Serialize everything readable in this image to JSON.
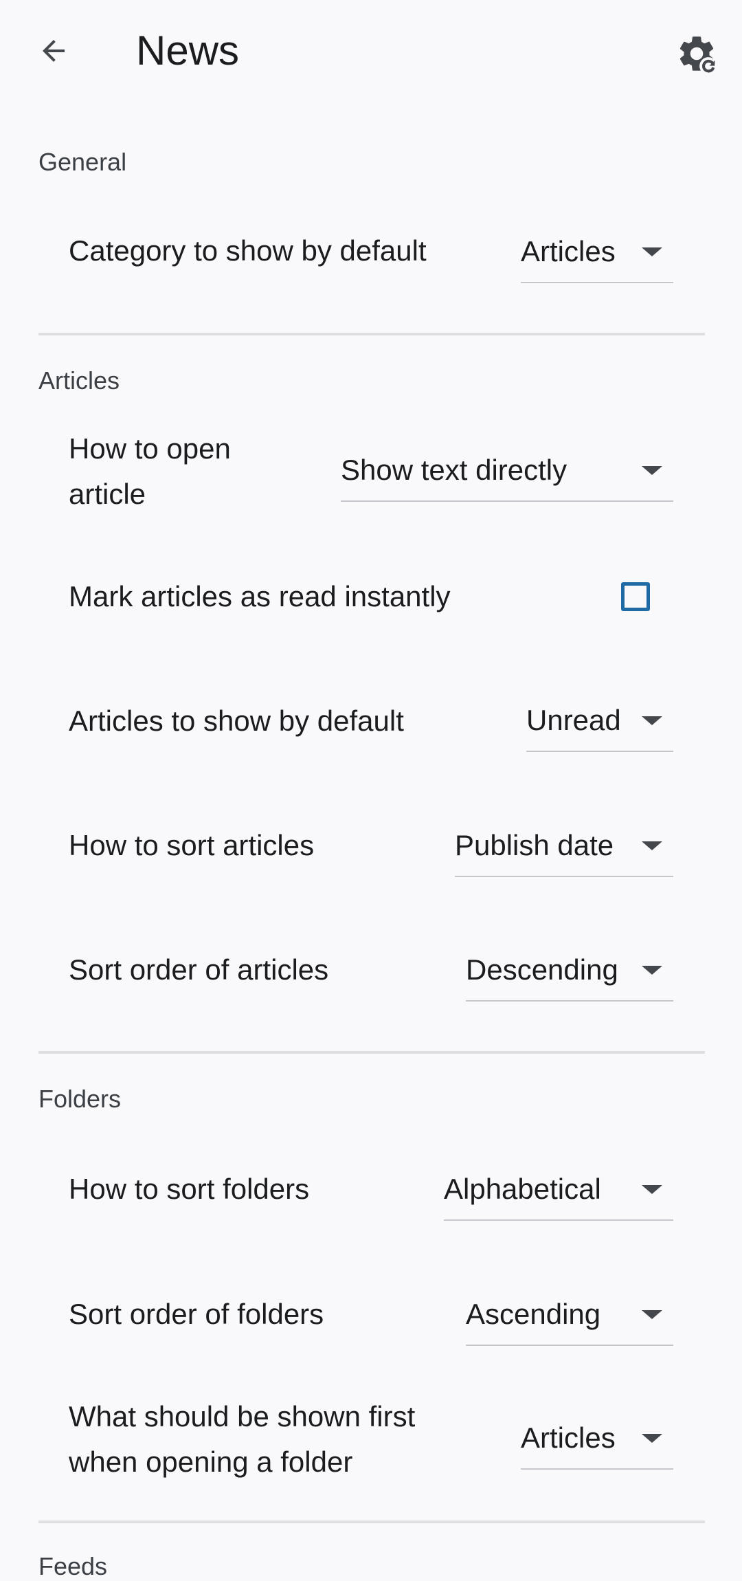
{
  "app_bar": {
    "title": "News",
    "back_icon": "arrow-left-icon",
    "settings_icon": "gear-sync-icon"
  },
  "sections": {
    "general": {
      "header": "General",
      "category_default": {
        "label": "Category to show by default",
        "value": "Articles"
      }
    },
    "articles": {
      "header": "Articles",
      "open_article": {
        "label_line1": "How to open",
        "label_line2": "article",
        "value": "Show text directly"
      },
      "mark_read": {
        "label": "Mark articles as read instantly",
        "checked": false
      },
      "show_default": {
        "label": "Articles to show by default",
        "value": "Unread"
      },
      "sort_by": {
        "label": "How to sort articles",
        "value": "Publish date"
      },
      "sort_order": {
        "label": "Sort order of articles",
        "value": "Descending"
      }
    },
    "folders": {
      "header": "Folders",
      "sort_by": {
        "label": "How to sort folders",
        "value": "Alphabetical"
      },
      "sort_order": {
        "label": "Sort order of folders",
        "value": "Ascending"
      },
      "shown_first": {
        "label_line1": "What should be shown first",
        "label_line2": "when opening a folder",
        "value": "Articles"
      }
    },
    "feeds": {
      "header": "Feeds"
    }
  },
  "colors": {
    "background": "#f9f9fc",
    "text": "#1a1c1e",
    "checkbox_border": "#1f6aa5",
    "divider": "#dedfe3"
  }
}
